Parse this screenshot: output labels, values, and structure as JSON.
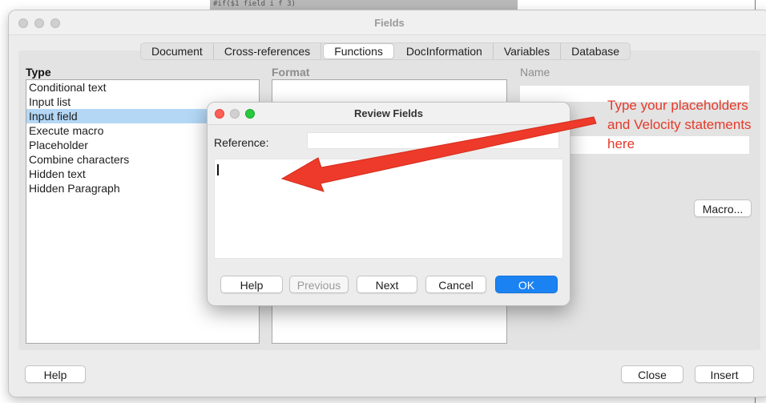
{
  "background": {
    "code_snippet": "#if($1      field                     i  f   3)",
    "colors": {
      "page_bg": "#ffffff",
      "code_bg": "#b9b9b9"
    }
  },
  "fields_window": {
    "title": "Fields",
    "tabs": [
      {
        "label": "Document",
        "active": false
      },
      {
        "label": "Cross-references",
        "active": false
      },
      {
        "label": "Functions",
        "active": true
      },
      {
        "label": "DocInformation",
        "active": false
      },
      {
        "label": "Variables",
        "active": false
      },
      {
        "label": "Database",
        "active": false
      }
    ],
    "type_label": "Type",
    "format_label": "Format",
    "name_label": "Name",
    "type_items": [
      {
        "label": "Conditional text",
        "selected": false
      },
      {
        "label": "Input list",
        "selected": false
      },
      {
        "label": "Input field",
        "selected": true
      },
      {
        "label": "Execute macro",
        "selected": false
      },
      {
        "label": "Placeholder",
        "selected": false
      },
      {
        "label": "Combine characters",
        "selected": false
      },
      {
        "label": "Hidden text",
        "selected": false
      },
      {
        "label": "Hidden Paragraph",
        "selected": false
      }
    ],
    "macro_button": "Macro...",
    "help_button": "Help",
    "close_button": "Close",
    "insert_button": "Insert",
    "colors": {
      "selection": "#b3d7f5"
    }
  },
  "review_dialog": {
    "title": "Review Fields",
    "reference_label": "Reference:",
    "reference_value": "",
    "text_value": "",
    "buttons": {
      "help": "Help",
      "previous": "Previous",
      "next": "Next",
      "cancel": "Cancel",
      "ok": "OK"
    },
    "colors": {
      "ok_button": "#1b82f2",
      "close_dot": "#ff5f57",
      "min_dot": "#d0d0d0",
      "zoom_dot": "#28c840"
    }
  },
  "annotation": {
    "lines": [
      "Type your placeholders",
      "and Velocity statements",
      "here"
    ],
    "color": "#e43a2a"
  }
}
